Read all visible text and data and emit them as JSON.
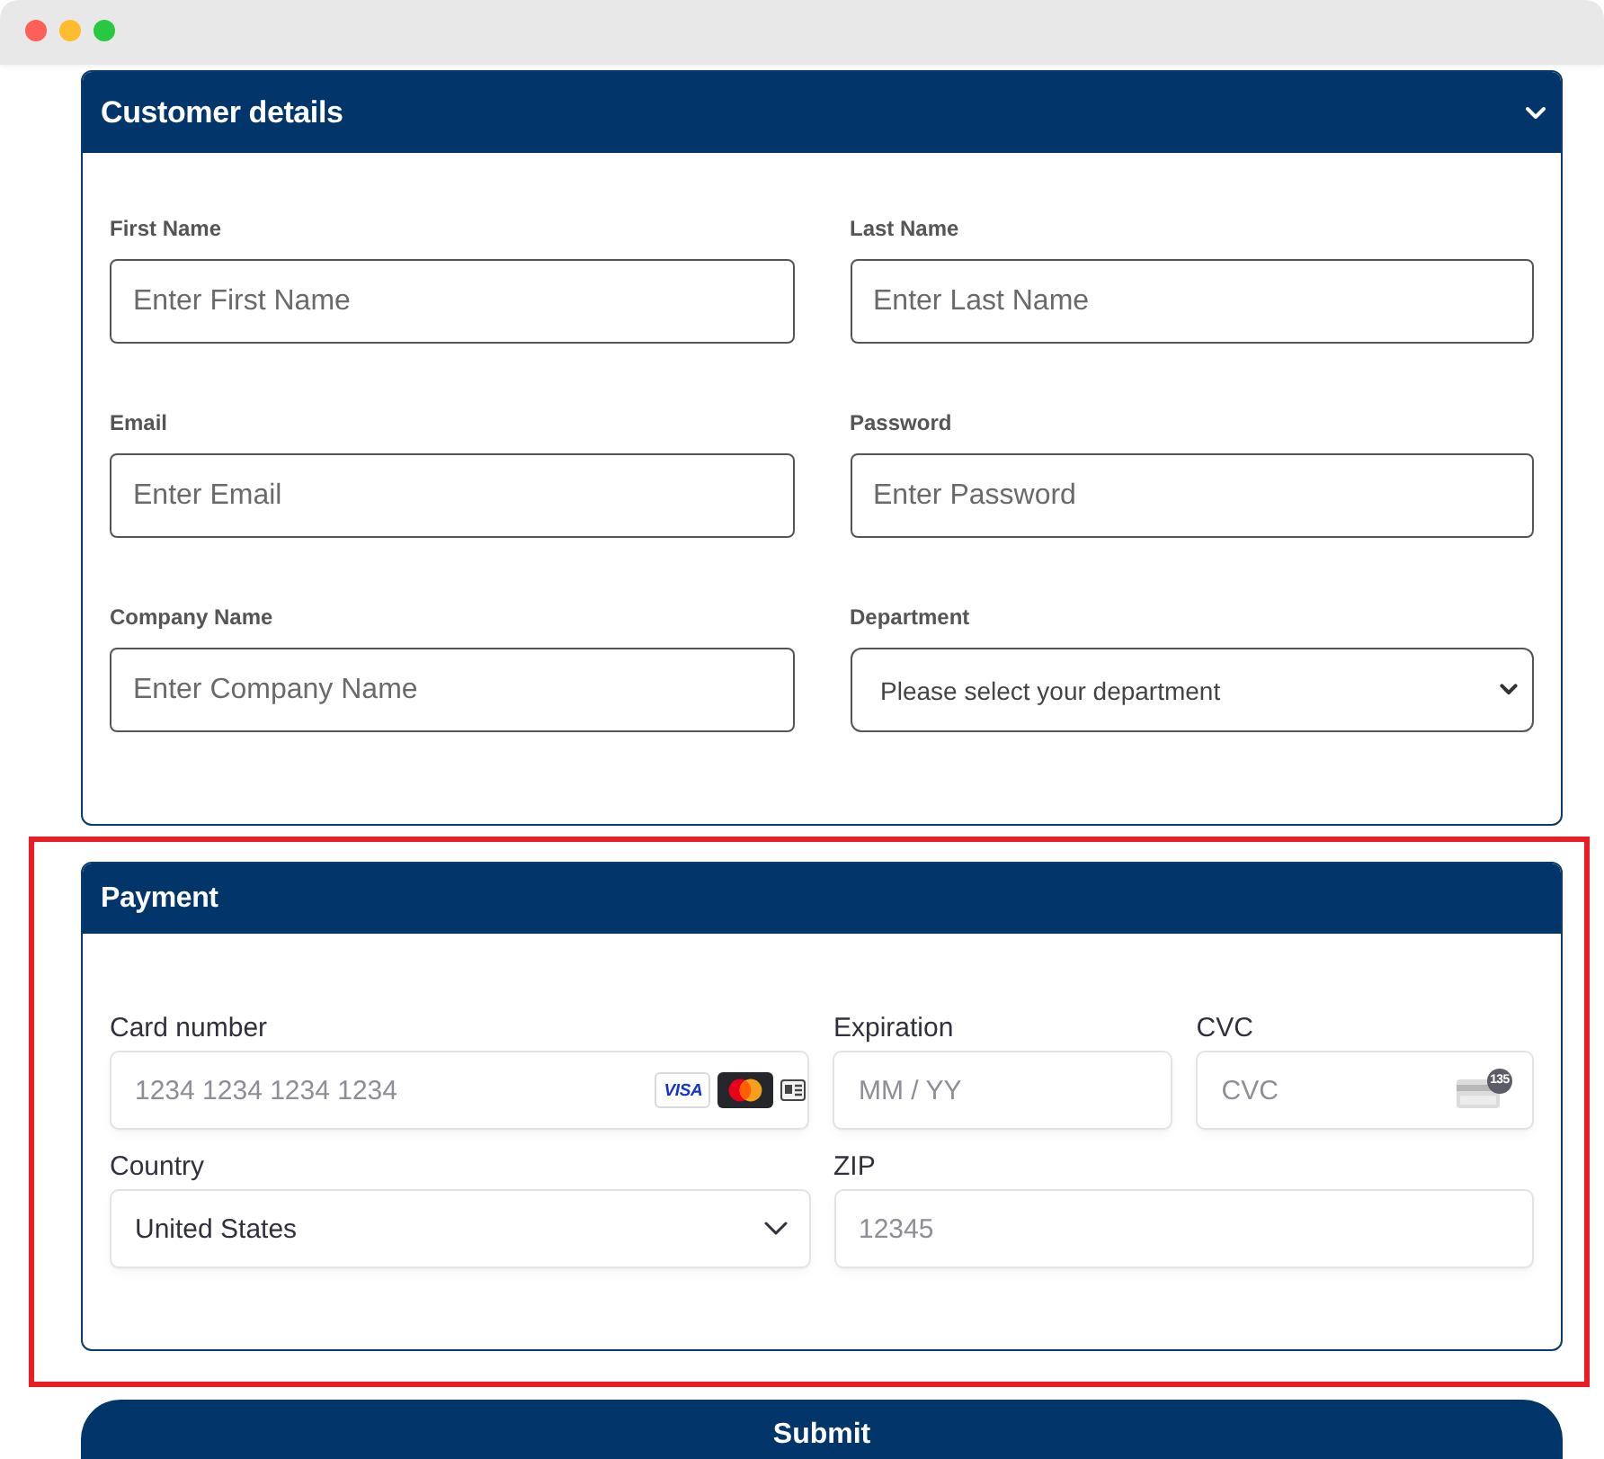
{
  "customer_details": {
    "title": "Customer details",
    "collapsible": true,
    "rows": [
      [
        {
          "kind": "text",
          "label": "First Name",
          "placeholder": "Enter First Name"
        },
        {
          "kind": "text",
          "label": "Last Name",
          "placeholder": "Enter Last Name"
        }
      ],
      [
        {
          "kind": "text",
          "label": "Email",
          "placeholder": "Enter Email"
        },
        {
          "kind": "text",
          "label": "Password",
          "placeholder": "Enter Password"
        }
      ],
      [
        {
          "kind": "text",
          "label": "Company Name",
          "placeholder": "Enter Company Name"
        },
        {
          "kind": "select",
          "label": "Department",
          "placeholder": "Please select your department"
        }
      ]
    ]
  },
  "payment": {
    "title": "Payment",
    "highlighted": true,
    "rows": [
      [
        {
          "kind": "card_number",
          "label": "Card number",
          "placeholder": "1234 1234 1234 1234",
          "brands": [
            {
              "kind": "visa",
              "text": "VISA"
            },
            {
              "kind": "mastercard"
            },
            {
              "kind": "generic"
            }
          ]
        },
        {
          "kind": "text",
          "label": "Expiration",
          "placeholder": "MM / YY"
        },
        {
          "kind": "cvc",
          "label": "CVC",
          "placeholder": "CVC",
          "badge": "135"
        }
      ],
      [
        {
          "kind": "select",
          "label": "Country",
          "value": "United States"
        },
        {
          "kind": "text",
          "label": "ZIP",
          "placeholder": "12345"
        }
      ]
    ]
  },
  "submit": {
    "label": "Submit"
  }
}
